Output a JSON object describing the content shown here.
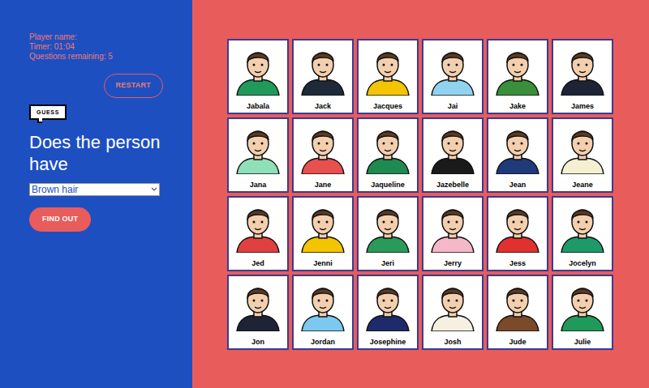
{
  "player": {
    "name_label": "Player name:",
    "timer": "Timer: 01:04",
    "questions": "Questions remaining: 5"
  },
  "restart_button": "RESTART",
  "guess_badge": "GUESS",
  "question": {
    "heading": "Does the person have",
    "select_value": "Brown hair"
  },
  "find_out_button": "FIND OUT",
  "characters": [
    {
      "name": "Jabala",
      "color": "#1f9a5a"
    },
    {
      "name": "Jack",
      "color": "#1e2a3a"
    },
    {
      "name": "Jacques",
      "color": "#f5c400"
    },
    {
      "name": "Jai",
      "color": "#8fd3f0"
    },
    {
      "name": "Jake",
      "color": "#3a8f3a"
    },
    {
      "name": "James",
      "color": "#1e2436"
    },
    {
      "name": "Jana",
      "color": "#8fe0b8"
    },
    {
      "name": "Jane",
      "color": "#e85050"
    },
    {
      "name": "Jaqueline",
      "color": "#1f8a4f"
    },
    {
      "name": "Jazebelle",
      "color": "#1a1a1a"
    },
    {
      "name": "Jean",
      "color": "#1f3a7a"
    },
    {
      "name": "Jeane",
      "color": "#f5f0d0"
    },
    {
      "name": "Jed",
      "color": "#e04040"
    },
    {
      "name": "Jenni",
      "color": "#f5c400"
    },
    {
      "name": "Jeri",
      "color": "#2a9a5a"
    },
    {
      "name": "Jerry",
      "color": "#f5b8c8"
    },
    {
      "name": "Jess",
      "color": "#e03030"
    },
    {
      "name": "Jocelyn",
      "color": "#1e9a6a"
    },
    {
      "name": "Jon",
      "color": "#1e2436"
    },
    {
      "name": "Jordan",
      "color": "#7cc8f0"
    },
    {
      "name": "Josephine",
      "color": "#1e2a6a"
    },
    {
      "name": "Josh",
      "color": "#f5f0e0"
    },
    {
      "name": "Jude",
      "color": "#7a4a2a"
    },
    {
      "name": "Julie",
      "color": "#1f9a5a"
    }
  ]
}
